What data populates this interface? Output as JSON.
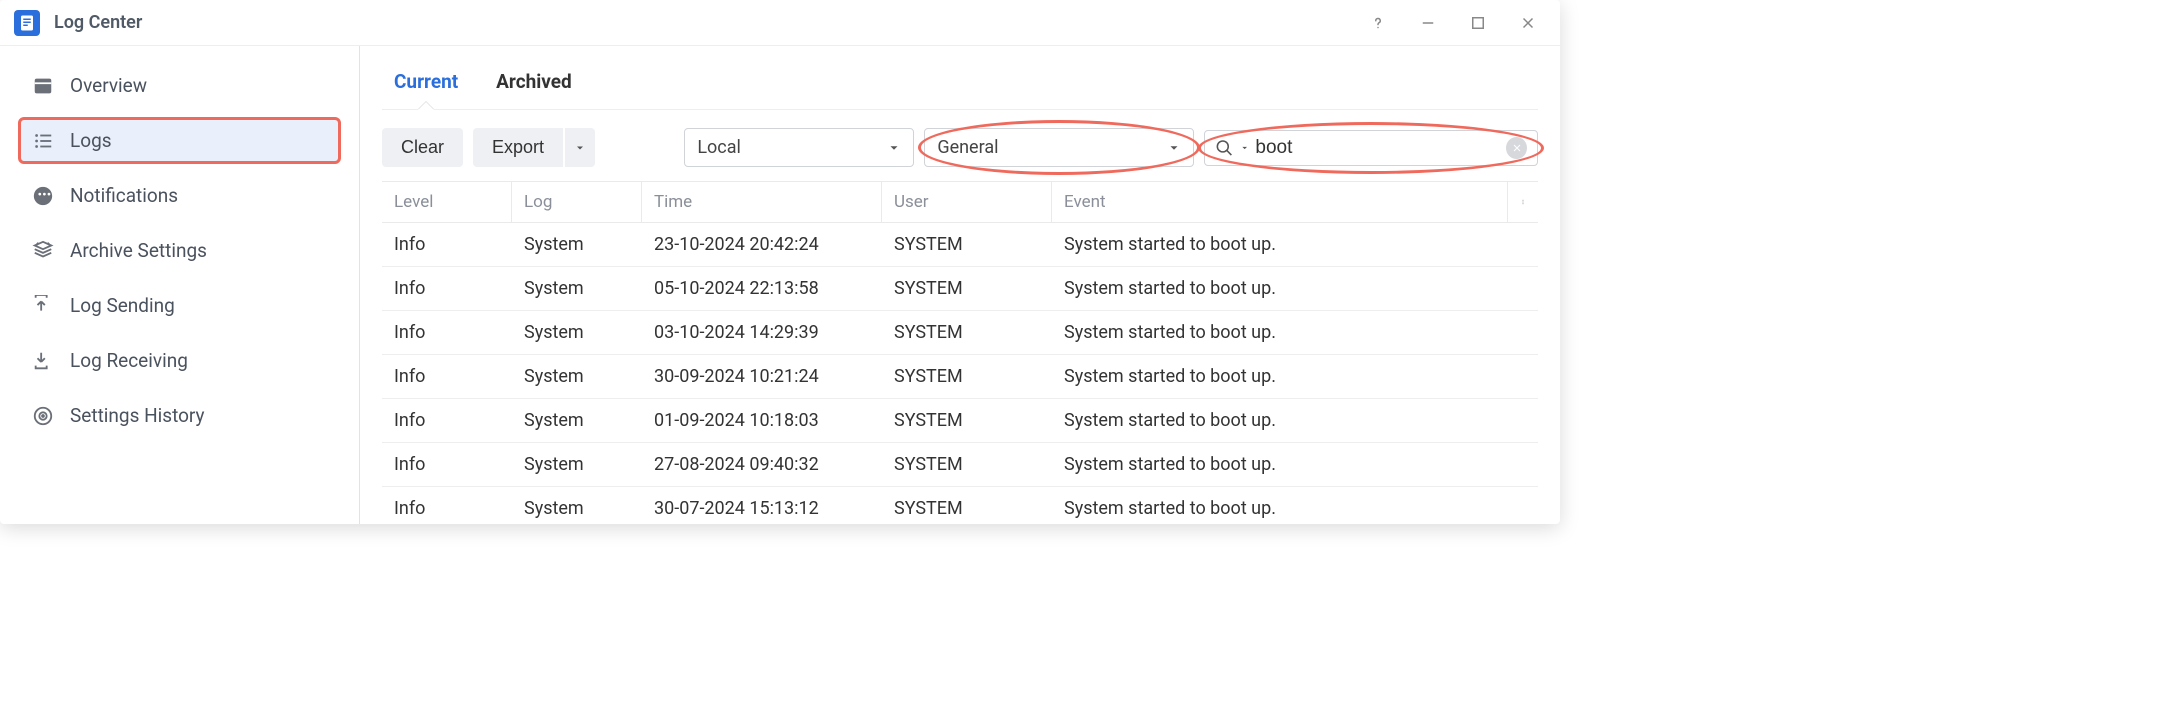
{
  "window": {
    "title": "Log Center"
  },
  "titlebar_tooltips": {
    "help": "Help",
    "minimize": "Minimize",
    "maximize": "Maximize",
    "close": "Close"
  },
  "sidebar": {
    "items": [
      {
        "label": "Overview"
      },
      {
        "label": "Logs"
      },
      {
        "label": "Notifications"
      },
      {
        "label": "Archive Settings"
      },
      {
        "label": "Log Sending"
      },
      {
        "label": "Log Receiving"
      },
      {
        "label": "Settings History"
      }
    ],
    "active_index": 1
  },
  "tabs": {
    "items": [
      {
        "label": "Current"
      },
      {
        "label": "Archived"
      }
    ],
    "active_index": 0
  },
  "toolbar": {
    "clear_label": "Clear",
    "export_label": "Export",
    "source_select": "Local",
    "category_select": "General",
    "search_value": "boot"
  },
  "table": {
    "columns": [
      "Level",
      "Log",
      "Time",
      "User",
      "Event"
    ],
    "rows": [
      {
        "level": "Info",
        "log": "System",
        "time": "23-10-2024 20:42:24",
        "user": "SYSTEM",
        "event": "System started to boot up."
      },
      {
        "level": "Info",
        "log": "System",
        "time": "05-10-2024 22:13:58",
        "user": "SYSTEM",
        "event": "System started to boot up."
      },
      {
        "level": "Info",
        "log": "System",
        "time": "03-10-2024 14:29:39",
        "user": "SYSTEM",
        "event": "System started to boot up."
      },
      {
        "level": "Info",
        "log": "System",
        "time": "30-09-2024 10:21:24",
        "user": "SYSTEM",
        "event": "System started to boot up."
      },
      {
        "level": "Info",
        "log": "System",
        "time": "01-09-2024 10:18:03",
        "user": "SYSTEM",
        "event": "System started to boot up."
      },
      {
        "level": "Info",
        "log": "System",
        "time": "27-08-2024 09:40:32",
        "user": "SYSTEM",
        "event": "System started to boot up."
      },
      {
        "level": "Info",
        "log": "System",
        "time": "30-07-2024 15:13:12",
        "user": "SYSTEM",
        "event": "System started to boot up."
      }
    ]
  },
  "highlights": {
    "sidebar_item": 1,
    "category_select": true,
    "search": true
  }
}
